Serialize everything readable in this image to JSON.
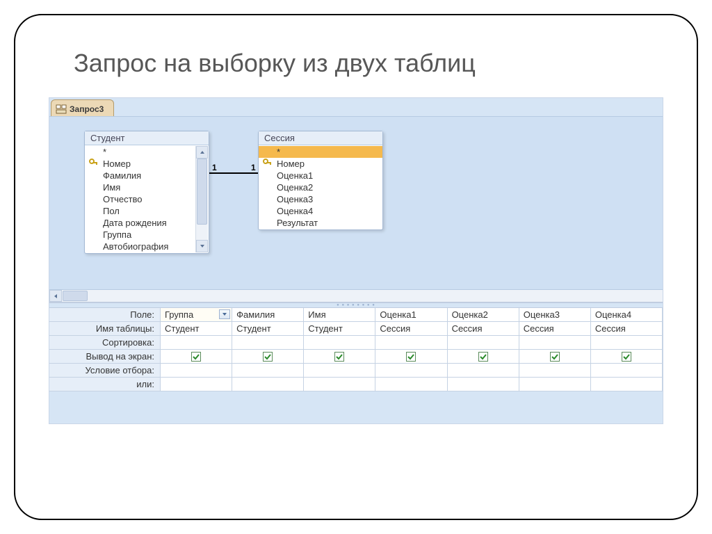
{
  "slide_title": "Запрос на выборку из двух таблиц",
  "tab": {
    "label": "Запрос3"
  },
  "relationship": {
    "left_card": "1",
    "right_card": "1"
  },
  "tables": {
    "student": {
      "title": "Студент",
      "fields": {
        "star": "*",
        "f0": "Номер",
        "f1": "Фамилия",
        "f2": "Имя",
        "f3": "Отчество",
        "f4": "Пол",
        "f5": "Дата рождения",
        "f6": "Группа",
        "f7": "Автобиография"
      }
    },
    "session": {
      "title": "Сессия",
      "fields": {
        "star": "*",
        "f0": "Номер",
        "f1": "Оценка1",
        "f2": "Оценка2",
        "f3": "Оценка3",
        "f4": "Оценка4",
        "f5": "Результат"
      }
    }
  },
  "qbe": {
    "labels": {
      "field": "Поле:",
      "table": "Имя таблицы:",
      "sort": "Сортировка:",
      "show": "Вывод на экран:",
      "criteria": "Условие отбора:",
      "or": "или:"
    },
    "columns": [
      {
        "field": "Группа",
        "table": "Студент",
        "show": true,
        "active": true
      },
      {
        "field": "Фамилия",
        "table": "Студент",
        "show": true
      },
      {
        "field": "Имя",
        "table": "Студент",
        "show": true
      },
      {
        "field": "Оценка1",
        "table": "Сессия",
        "show": true
      },
      {
        "field": "Оценка2",
        "table": "Сессия",
        "show": true
      },
      {
        "field": "Оценка3",
        "table": "Сессия",
        "show": true
      },
      {
        "field": "Оценка4",
        "table": "Сессия",
        "show": true
      }
    ]
  }
}
